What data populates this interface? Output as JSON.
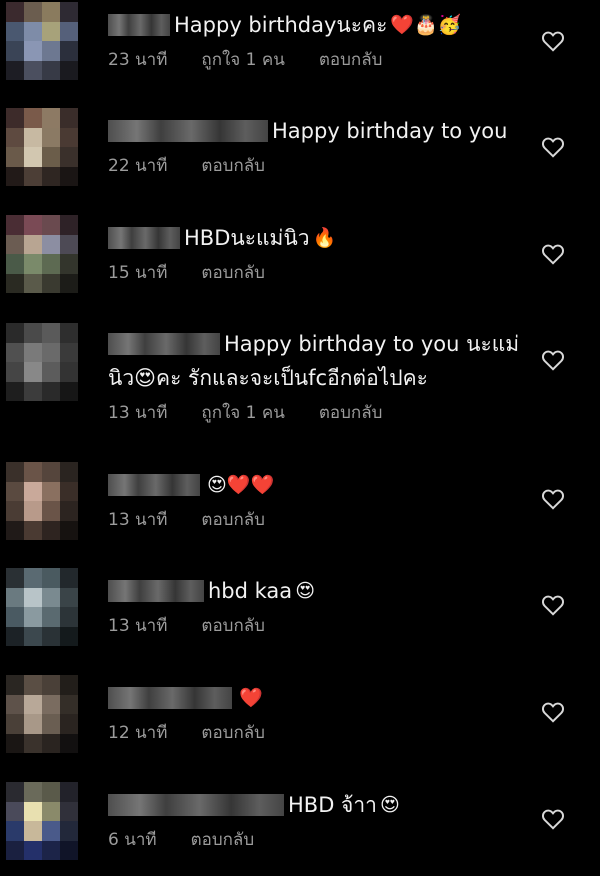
{
  "comments": [
    {
      "text": "Happy birthdayนะคะ",
      "text2": "",
      "emojis": "❤️🎂🥳",
      "time": "23 นาที",
      "likes": "ถูกใจ 1 คน",
      "reply": "ตอบกลับ"
    },
    {
      "text": "Happy birthday to you",
      "text2": "",
      "emojis": "",
      "time": "22 นาที",
      "likes": "",
      "reply": "ตอบกลับ"
    },
    {
      "text": "HBDนะแม่นิว",
      "text2": "",
      "emojis": "🔥",
      "time": "15 นาที",
      "likes": "",
      "reply": "ตอบกลับ"
    },
    {
      "text": "Happy birthday to you นะแม่",
      "text2": "นิว😍คะ  รักและจะเป็นfcอีกต่อไปคะ",
      "emojis": "",
      "time": "13 นาที",
      "likes": "ถูกใจ 1 คน",
      "reply": "ตอบกลับ"
    },
    {
      "text": "",
      "text2": "",
      "emojis": "😍❤️❤️",
      "time": "13 นาที",
      "likes": "",
      "reply": "ตอบกลับ"
    },
    {
      "text": "hbd kaa",
      "text2": "",
      "emojis": "😍",
      "time": "13 นาที",
      "likes": "",
      "reply": "ตอบกลับ"
    },
    {
      "text": "",
      "text2": "",
      "emojis": "❤️",
      "time": "12 นาที",
      "likes": "",
      "reply": "ตอบกลับ"
    },
    {
      "text": "HBD จ้าา",
      "text2": "",
      "emojis": "😍",
      "time": "6 นาที",
      "likes": "",
      "reply": "ตอบกลับ"
    }
  ],
  "colors": {
    "background": "#000000",
    "text": "#f2f2f2",
    "meta": "#9c9c9c",
    "heart_icon_stroke": "#d8d8d8"
  },
  "icons": {
    "like": "heart-outline-icon"
  }
}
